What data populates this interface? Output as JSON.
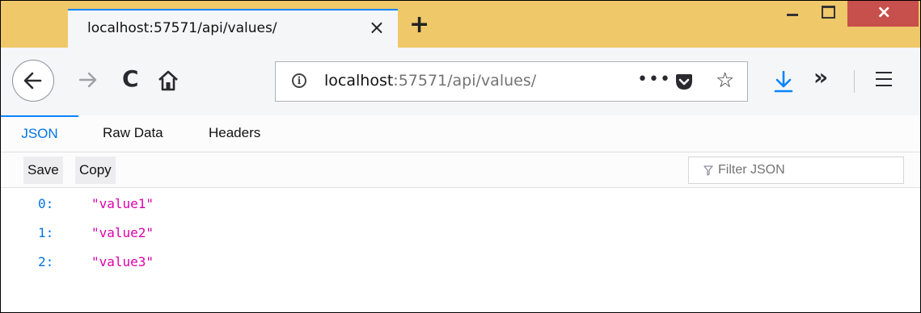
{
  "tab": {
    "title": "localhost:57571/api/values/",
    "close": "×",
    "new_tab": "+"
  },
  "window_controls": {
    "close": "×"
  },
  "urlbar": {
    "host": "localhost",
    "rest": ":57571/api/values/",
    "info": "i",
    "page_actions": "•••",
    "bookmark": "☆"
  },
  "toolbar_icons": {
    "reload": "C",
    "overflow": "»"
  },
  "viewer": {
    "tabs": [
      {
        "label": "JSON"
      },
      {
        "label": "Raw Data"
      },
      {
        "label": "Headers"
      }
    ],
    "active_tab": "JSON",
    "save_label": "Save",
    "copy_label": "Copy",
    "filter_placeholder": "Filter JSON"
  },
  "json": {
    "rows": [
      {
        "key": "0:",
        "value": "\"value1\""
      },
      {
        "key": "1:",
        "value": "\"value2\""
      },
      {
        "key": "2:",
        "value": "\"value3\""
      }
    ]
  },
  "colors": {
    "titlebar": "#efc86a",
    "accent": "#0a84ff",
    "key": "#0074e8",
    "string": "#dd00a9",
    "close_button": "#c74f4c"
  }
}
